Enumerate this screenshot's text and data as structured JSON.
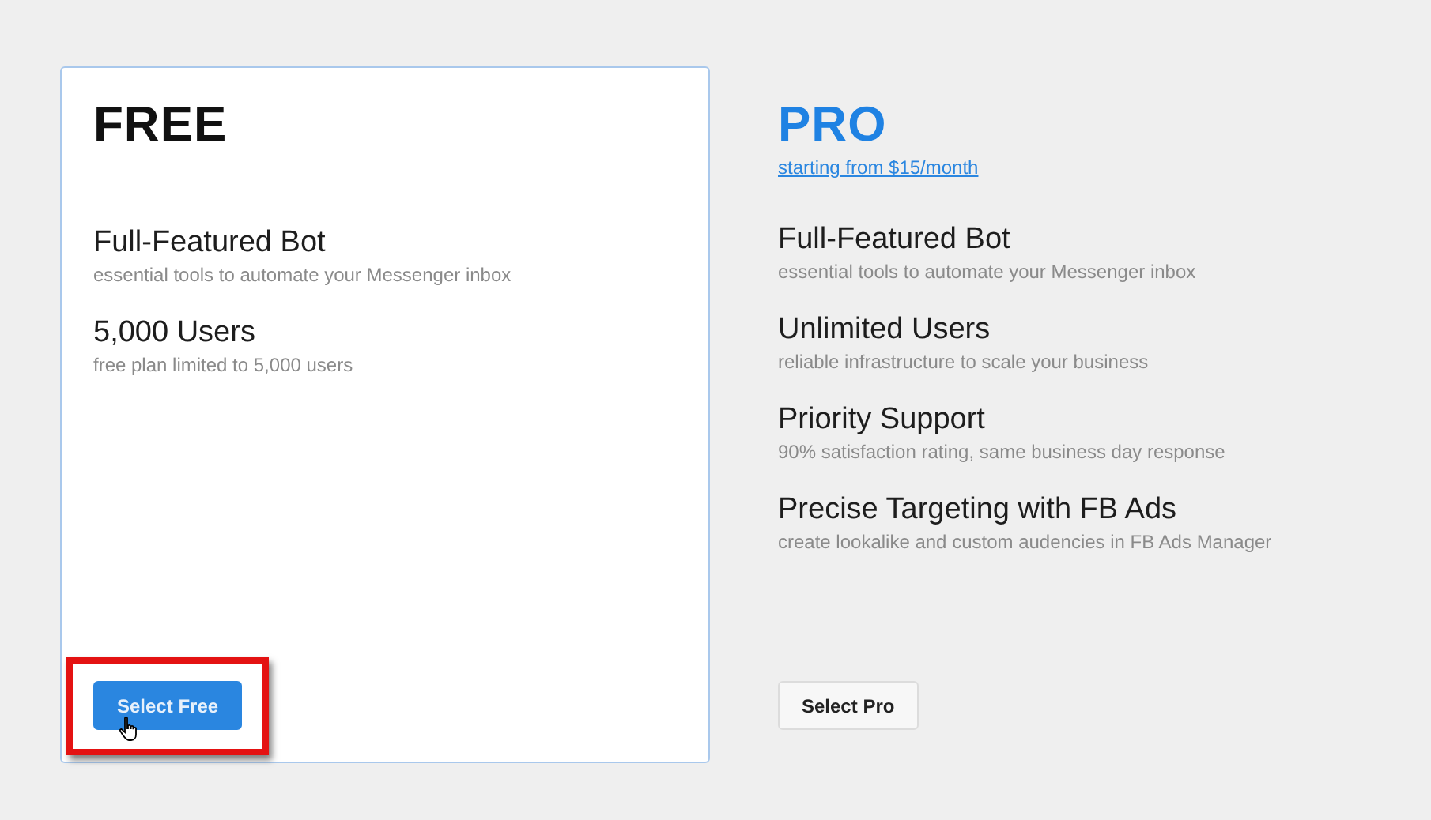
{
  "plans": [
    {
      "name": "FREE",
      "selected": true,
      "features": [
        {
          "title": "Full-Featured Bot",
          "description": "essential tools to automate your Messenger inbox"
        },
        {
          "title": "5,000 Users",
          "description": "free plan limited to 5,000 users"
        }
      ],
      "button": {
        "label": "Select Free",
        "kind": "primary",
        "highlighted": true,
        "hovered": true
      }
    },
    {
      "name": "PRO",
      "selected": false,
      "price_link": "starting from $15/month",
      "features": [
        {
          "title": "Full-Featured Bot",
          "description": "essential tools to automate your Messenger inbox"
        },
        {
          "title": "Unlimited Users",
          "description": "reliable infrastructure to scale your business"
        },
        {
          "title": "Priority Support",
          "description": "90% satisfaction rating, same business day response"
        },
        {
          "title": "Precise Targeting with FB Ads",
          "description": "create lookalike and custom audencies in FB Ads Manager"
        }
      ],
      "button": {
        "label": "Select Pro",
        "kind": "secondary",
        "highlighted": false,
        "hovered": false
      }
    }
  ]
}
